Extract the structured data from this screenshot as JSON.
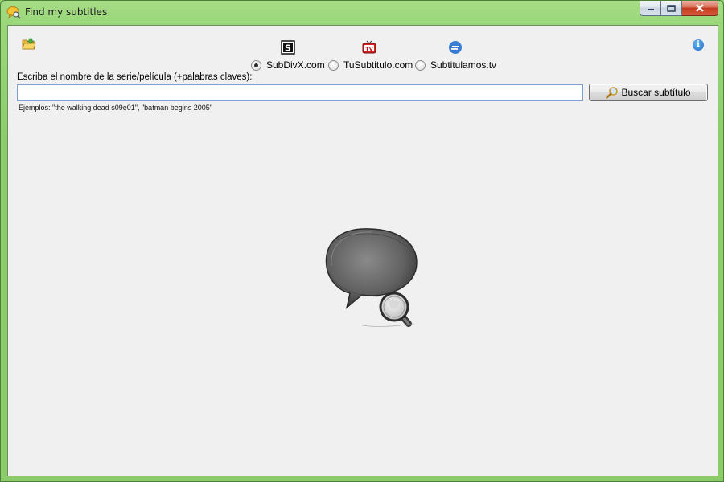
{
  "window": {
    "title": "Find my subtitles",
    "app_icon": "speech-bubble-magnifier-icon",
    "frame_color": "#9ad77a"
  },
  "toolbar": {
    "open_folder_icon": "folder-icon",
    "info_icon": "info-icon",
    "info_glyph": "i"
  },
  "providers": [
    {
      "label": "SubDivX.com",
      "logo": "subdivx-logo-icon",
      "logo_text": "S",
      "selected": true
    },
    {
      "label": "TuSubtitulo.com",
      "logo": "tusubtitulo-tv-icon",
      "logo_text": "TV",
      "selected": false
    },
    {
      "label": "Subtitulamos.tv",
      "logo": "subtitulamos-logo-icon",
      "selected": false
    }
  ],
  "search": {
    "prompt": "Escriba el nombre de la serie/película (+palabras claves):",
    "value": "",
    "button_label": "Buscar subtítulo",
    "button_icon": "magnifier-icon",
    "examples": "Ejemplos: \"the walking dead s09e01\", \"batman begins 2005\""
  },
  "main": {
    "illustration": "speech-bubble-magnifier-illustration"
  }
}
